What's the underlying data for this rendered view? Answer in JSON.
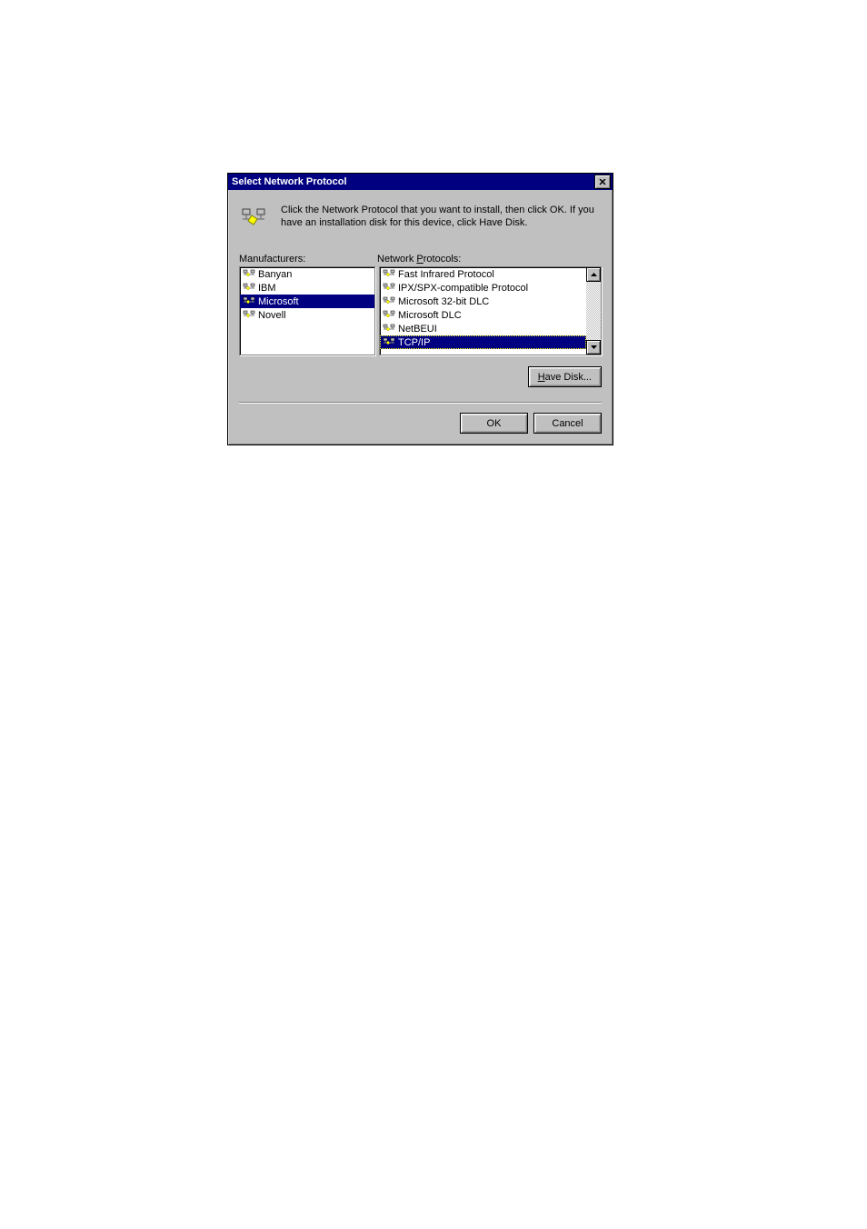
{
  "dialog": {
    "title": "Select Network Protocol",
    "intro": "Click the Network Protocol that you want to install, then click OK. If you have an installation disk for this device, click Have Disk.",
    "manufacturers_label": "Manufacturers:",
    "protocols_label_pre": "Network ",
    "protocols_label_u": "P",
    "protocols_label_post": "rotocols:",
    "manufacturers": [
      {
        "name": "Banyan",
        "selected": false
      },
      {
        "name": "IBM",
        "selected": false
      },
      {
        "name": "Microsoft",
        "selected": true
      },
      {
        "name": "Novell",
        "selected": false
      }
    ],
    "protocols": [
      {
        "name": "Fast Infrared Protocol",
        "selected": false
      },
      {
        "name": "IPX/SPX-compatible Protocol",
        "selected": false
      },
      {
        "name": "Microsoft 32-bit DLC",
        "selected": false
      },
      {
        "name": "Microsoft DLC",
        "selected": false
      },
      {
        "name": "NetBEUI",
        "selected": false
      },
      {
        "name": "TCP/IP",
        "selected": true
      }
    ],
    "have_disk_pre": "",
    "have_disk_u": "H",
    "have_disk_post": "ave Disk...",
    "ok": "OK",
    "cancel": "Cancel"
  }
}
